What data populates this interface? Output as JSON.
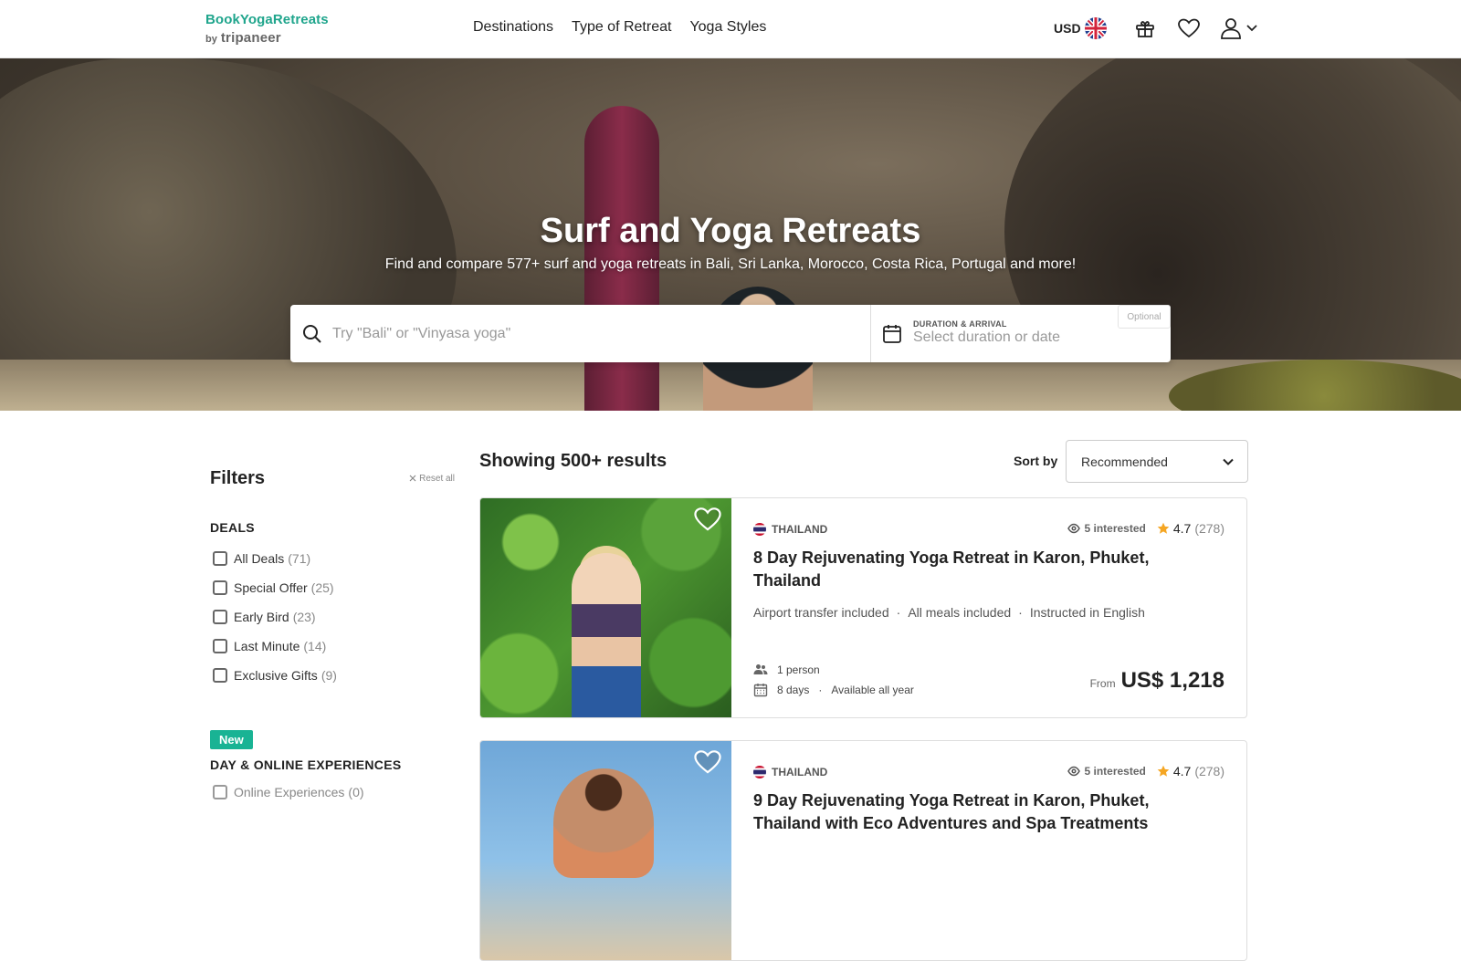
{
  "header": {
    "logo_main": "BookYogaRetreats",
    "logo_by": "by",
    "logo_brand": "tripaneer",
    "nav": [
      "Destinations",
      "Type of Retreat",
      "Yoga Styles"
    ],
    "currency": "USD"
  },
  "hero": {
    "title": "Surf and Yoga Retreats",
    "subtitle": "Find and compare 577+ surf and yoga retreats in Bali, Sri Lanka, Morocco, Costa Rica, Portugal and more!",
    "search_placeholder": "Try \"Bali\" or \"Vinyasa yoga\"",
    "duration_label": "DURATION & ARRIVAL",
    "duration_placeholder": "Select duration or date",
    "optional_label": "Optional"
  },
  "filters": {
    "title": "Filters",
    "reset_label": "Reset all",
    "deals_title": "DEALS",
    "deals": [
      {
        "label": "All Deals",
        "count": "(71)"
      },
      {
        "label": "Special Offer",
        "count": "(25)"
      },
      {
        "label": "Early Bird",
        "count": "(23)"
      },
      {
        "label": "Last Minute",
        "count": "(14)"
      },
      {
        "label": "Exclusive Gifts",
        "count": "(9)"
      }
    ],
    "new_badge": "New",
    "experiences_title": "DAY & ONLINE EXPERIENCES",
    "experiences": [
      {
        "label": "Online Experiences",
        "count": "(0)"
      }
    ]
  },
  "results": {
    "count_text": "Showing 500+ results",
    "sort_label": "Sort by",
    "sort_value": "Recommended",
    "cards": [
      {
        "country": "THAILAND",
        "interested": "5 interested",
        "rating": "4.7",
        "reviews": "(278)",
        "title": "8 Day Rejuvenating Yoga Retreat in Karon, Phuket, Thailand",
        "features": [
          "Airport transfer included",
          "All meals included",
          "Instructed in English"
        ],
        "people": "1 person",
        "days": "8 days",
        "availability": "Available all year",
        "from_label": "From",
        "price": "US$ 1,218"
      },
      {
        "country": "THAILAND",
        "interested": "5 interested",
        "rating": "4.7",
        "reviews": "(278)",
        "title": "9 Day Rejuvenating Yoga Retreat in Karon, Phuket, Thailand with Eco Adventures and Spa Treatments"
      }
    ]
  },
  "colors": {
    "brand_green": "#1fa58c",
    "badge_green": "#19b394",
    "star_orange": "#f5a623"
  },
  "icons": [
    "uk-flag-icon",
    "gift-icon",
    "heart-icon",
    "user-icon",
    "chevron-down-icon",
    "search-icon",
    "calendar-icon",
    "close-icon",
    "eye-icon",
    "star-icon",
    "people-icon",
    "thai-flag-icon"
  ]
}
